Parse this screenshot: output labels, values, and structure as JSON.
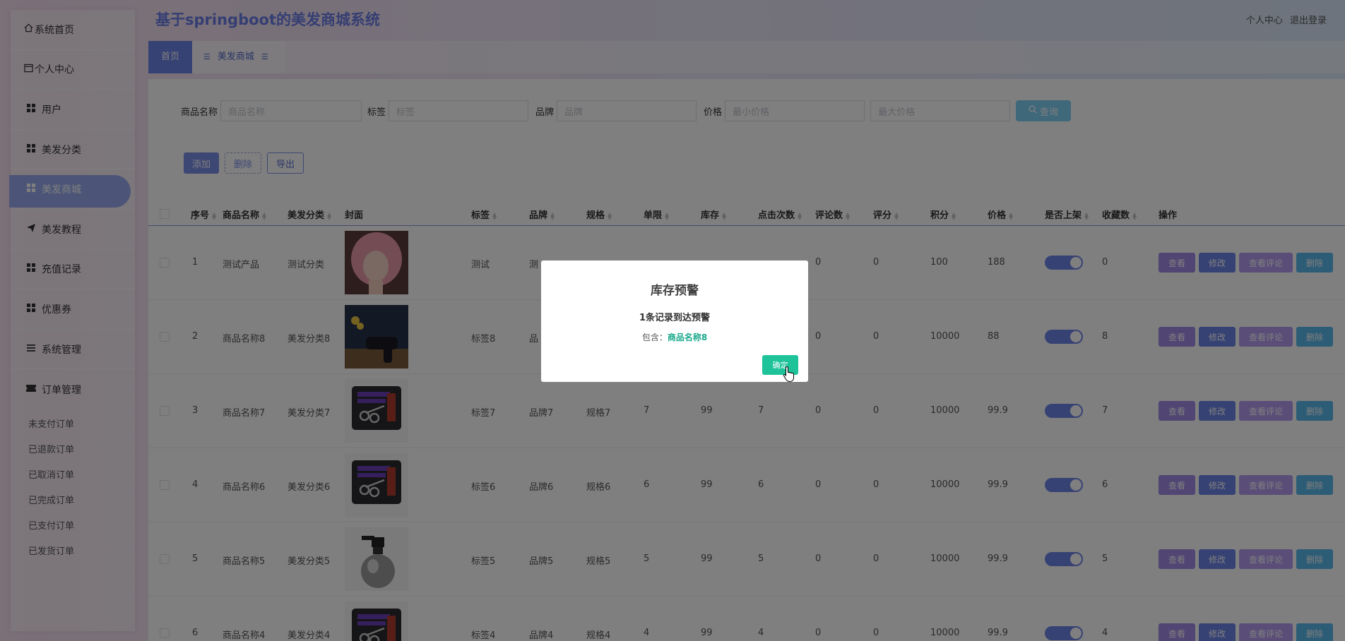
{
  "header": {
    "title": "基于springboot的美发商城系统",
    "links": [
      "个人中心",
      "退出登录"
    ]
  },
  "sidebar": {
    "items": [
      {
        "label": "系统首页",
        "icon": "home-icon"
      },
      {
        "label": "个人中心",
        "icon": "window-icon"
      },
      {
        "label": "用户",
        "icon": "grid-icon"
      },
      {
        "label": "美发分类",
        "icon": "grid-icon"
      },
      {
        "label": "美发商城",
        "icon": "grid-icon",
        "active": true
      },
      {
        "label": "美发教程",
        "icon": "send-icon"
      },
      {
        "label": "充值记录",
        "icon": "grid-icon"
      },
      {
        "label": "优惠券",
        "icon": "grid-icon"
      },
      {
        "label": "系统管理",
        "icon": "list-icon"
      },
      {
        "label": "订单管理",
        "icon": "ticket-icon"
      }
    ],
    "order_submenu": [
      "未支付订单",
      "已退款订单",
      "已取消订单",
      "已完成订单",
      "已支付订单",
      "已发货订单"
    ]
  },
  "tabs": {
    "home": "首页",
    "current": "美发商城"
  },
  "search": {
    "name_label": "商品名称",
    "name_placeholder": "商品名称",
    "tag_label": "标签",
    "tag_placeholder": "标签",
    "brand_label": "品牌",
    "brand_placeholder": "品牌",
    "price_label": "价格",
    "min_placeholder": "最小价格",
    "max_placeholder": "最大价格",
    "query_label": "查询"
  },
  "actions": {
    "add": "添加",
    "delete": "删除",
    "export": "导出"
  },
  "table": {
    "headers": [
      "序号",
      "商品名称",
      "美发分类",
      "封面",
      "标签",
      "品牌",
      "规格",
      "单限",
      "库存",
      "点击次数",
      "评论数",
      "评分",
      "积分",
      "价格",
      "是否上架",
      "收藏数",
      "操作"
    ],
    "row_buttons": {
      "view": "查看",
      "edit": "修改",
      "comments": "查看评论",
      "delete": "删除"
    },
    "rows": [
      {
        "no": "1",
        "name": "测试产品",
        "category": "测试分类",
        "cover": "pink-hair",
        "tag": "测试",
        "brand": "测",
        "spec": "",
        "limit": "",
        "stock": "",
        "clicks": "",
        "comments": "0",
        "rating": "0",
        "points": "100",
        "price": "188",
        "on_shelf": true,
        "favorites": "0"
      },
      {
        "no": "2",
        "name": "商品名称8",
        "category": "美发分类8",
        "cover": "hair-dryer",
        "tag": "标签8",
        "brand": "品",
        "spec": "",
        "limit": "",
        "stock": "",
        "clicks": "",
        "comments": "0",
        "rating": "0",
        "points": "10000",
        "price": "88",
        "on_shelf": true,
        "favorites": "8"
      },
      {
        "no": "3",
        "name": "商品名称7",
        "category": "美发分类7",
        "cover": "scissors-kit",
        "tag": "标签7",
        "brand": "品牌7",
        "spec": "规格7",
        "limit": "7",
        "stock": "99",
        "clicks": "7",
        "comments": "0",
        "rating": "0",
        "points": "10000",
        "price": "99.9",
        "on_shelf": true,
        "favorites": "7"
      },
      {
        "no": "4",
        "name": "商品名称6",
        "category": "美发分类6",
        "cover": "scissors-kit",
        "tag": "标签6",
        "brand": "品牌6",
        "spec": "规格6",
        "limit": "6",
        "stock": "99",
        "clicks": "6",
        "comments": "0",
        "rating": "0",
        "points": "10000",
        "price": "99.9",
        "on_shelf": true,
        "favorites": "6"
      },
      {
        "no": "5",
        "name": "商品名称5",
        "category": "美发分类5",
        "cover": "spray-bottle",
        "tag": "标签5",
        "brand": "品牌5",
        "spec": "规格5",
        "limit": "5",
        "stock": "99",
        "clicks": "5",
        "comments": "0",
        "rating": "0",
        "points": "10000",
        "price": "99.9",
        "on_shelf": true,
        "favorites": "5"
      },
      {
        "no": "6",
        "name": "商品名称4",
        "category": "美发分类4",
        "cover": "scissors-kit",
        "tag": "标签4",
        "brand": "品牌4",
        "spec": "规格4",
        "limit": "4",
        "stock": "99",
        "clicks": "4",
        "comments": "0",
        "rating": "0",
        "points": "10000",
        "price": "99.9",
        "on_shelf": true,
        "favorites": "4"
      }
    ]
  },
  "dialog": {
    "title": "库存预警",
    "message": "1条记录到达预警",
    "detail_prefix": "包含：",
    "detail_item": "商品名称8",
    "ok_label": "确定"
  },
  "colors": {
    "primary": "#6e84e8",
    "success": "#1ec39a",
    "title": "#6b7de6"
  }
}
